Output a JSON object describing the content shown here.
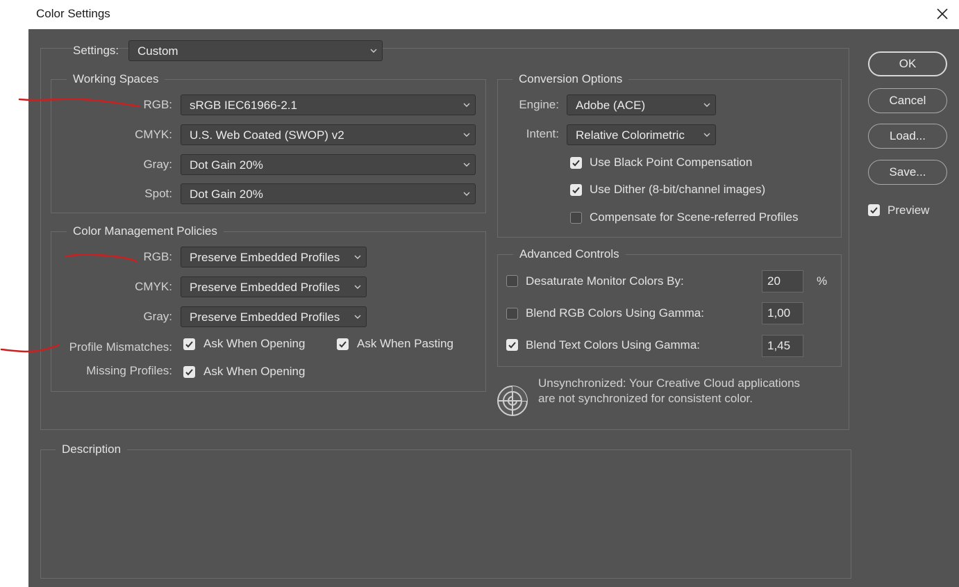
{
  "window": {
    "title": "Color Settings"
  },
  "settings": {
    "label": "Settings:",
    "value": "Custom"
  },
  "working_spaces": {
    "title": "Working Spaces",
    "rgb": {
      "label": "RGB:",
      "value": "sRGB IEC61966-2.1"
    },
    "cmyk": {
      "label": "CMYK:",
      "value": "U.S. Web Coated (SWOP) v2"
    },
    "gray": {
      "label": "Gray:",
      "value": "Dot Gain 20%"
    },
    "spot": {
      "label": "Spot:",
      "value": "Dot Gain 20%"
    }
  },
  "policies": {
    "title": "Color Management Policies",
    "rgb": {
      "label": "RGB:",
      "value": "Preserve Embedded Profiles"
    },
    "cmyk": {
      "label": "CMYK:",
      "value": "Preserve Embedded Profiles"
    },
    "gray": {
      "label": "Gray:",
      "value": "Preserve Embedded Profiles"
    },
    "mismatch": {
      "label": "Profile Mismatches:",
      "ask_opening": {
        "label": "Ask When Opening",
        "checked": true
      },
      "ask_pasting": {
        "label": "Ask When Pasting",
        "checked": true
      }
    },
    "missing": {
      "label": "Missing Profiles:",
      "ask_opening": {
        "label": "Ask When Opening",
        "checked": true
      }
    }
  },
  "conversion": {
    "title": "Conversion Options",
    "engine": {
      "label": "Engine:",
      "value": "Adobe (ACE)"
    },
    "intent": {
      "label": "Intent:",
      "value": "Relative Colorimetric"
    },
    "black_point": {
      "label": "Use Black Point Compensation",
      "checked": true
    },
    "dither": {
      "label": "Use Dither (8-bit/channel images)",
      "checked": true
    },
    "scene_referred": {
      "label": "Compensate for Scene-referred Profiles",
      "checked": false
    }
  },
  "advanced": {
    "title": "Advanced Controls",
    "desaturate": {
      "label": "Desaturate Monitor Colors By:",
      "value": "20",
      "unit": "%",
      "checked": false
    },
    "blend_rgb": {
      "label": "Blend RGB Colors Using Gamma:",
      "value": "1,00",
      "checked": false
    },
    "blend_text": {
      "label": "Blend Text Colors Using Gamma:",
      "value": "1,45",
      "checked": true
    }
  },
  "sync": {
    "line1": "Unsynchronized: Your Creative Cloud applications",
    "line2": "are not synchronized for consistent color.",
    "icon": "sync-status-icon"
  },
  "description": {
    "title": "Description",
    "body": ""
  },
  "buttons": {
    "ok": "OK",
    "cancel": "Cancel",
    "load": "Load...",
    "save": "Save..."
  },
  "preview": {
    "label": "Preview",
    "checked": true
  },
  "colors": {
    "dialog_bg": "#535353",
    "control_bg": "#454545",
    "text": "#e3e3e3",
    "annotation": "#cc1f1f"
  }
}
